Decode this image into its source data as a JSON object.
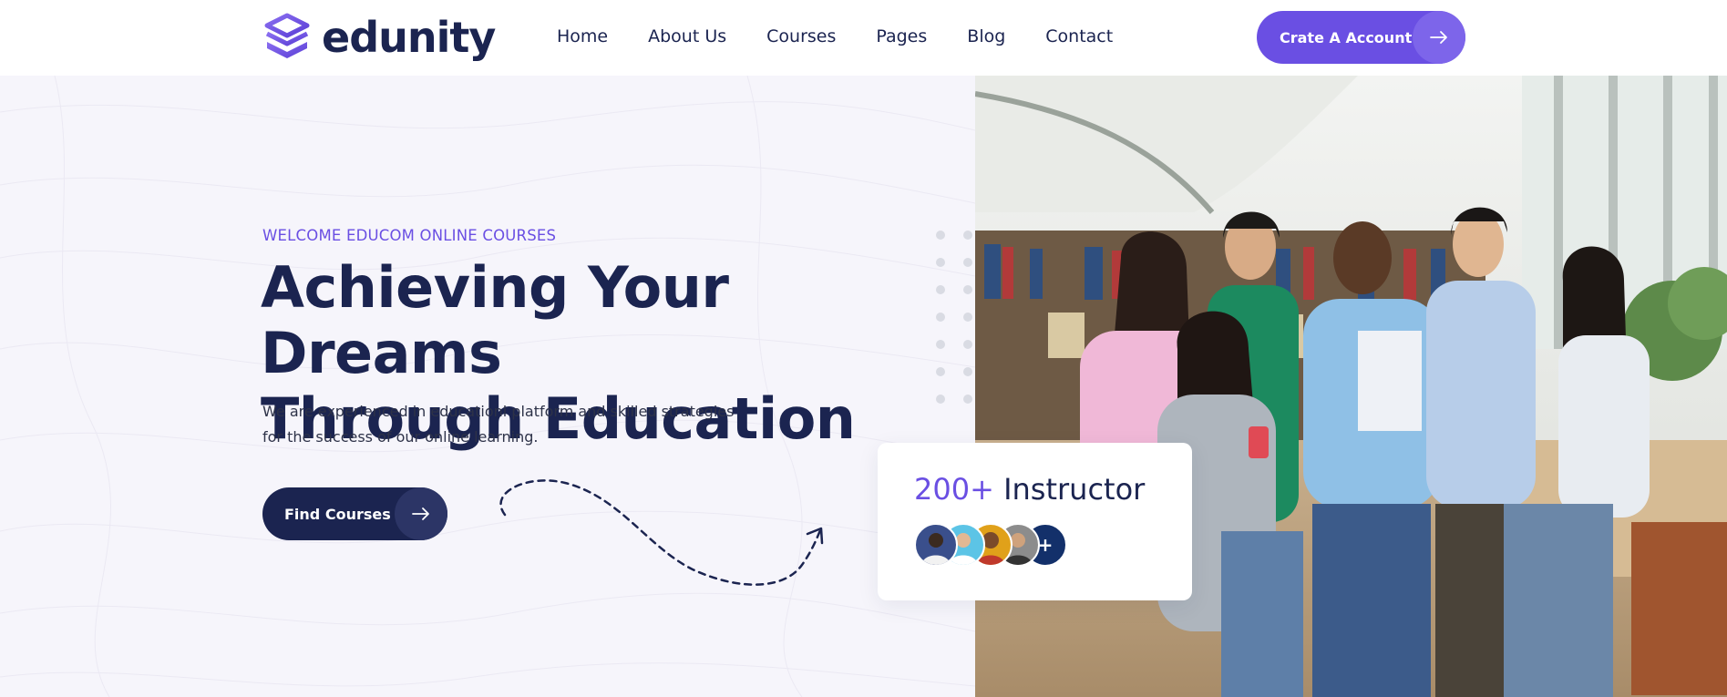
{
  "brand": {
    "name": "edunity",
    "color": "#6a4fe3",
    "dark": "#1b2450"
  },
  "nav": {
    "items": [
      {
        "label": "Home"
      },
      {
        "label": "About Us"
      },
      {
        "label": "Courses"
      },
      {
        "label": "Pages"
      },
      {
        "label": "Blog"
      },
      {
        "label": "Contact"
      }
    ],
    "cta_label": "Crate A Account",
    "cta_icon": "arrow-right-icon"
  },
  "hero": {
    "eyebrow": "WELCOME EDUCOM ONLINE COURSES",
    "headline_line1": "Achieving Your Dreams",
    "headline_line2": "Through Education",
    "subtext_line1": "We are experienced in educationl platform and skilled strategies",
    "subtext_line2": "for the success of our online learning.",
    "button_label": "Find Courses",
    "button_icon": "arrow-right-icon"
  },
  "instructor_card": {
    "count": "200+",
    "label": "Instructor",
    "more_symbol": "+",
    "avatar_colors": [
      "#3a4f8c",
      "#5cc4e6",
      "#e0a11a",
      "#4a4a4a"
    ]
  }
}
